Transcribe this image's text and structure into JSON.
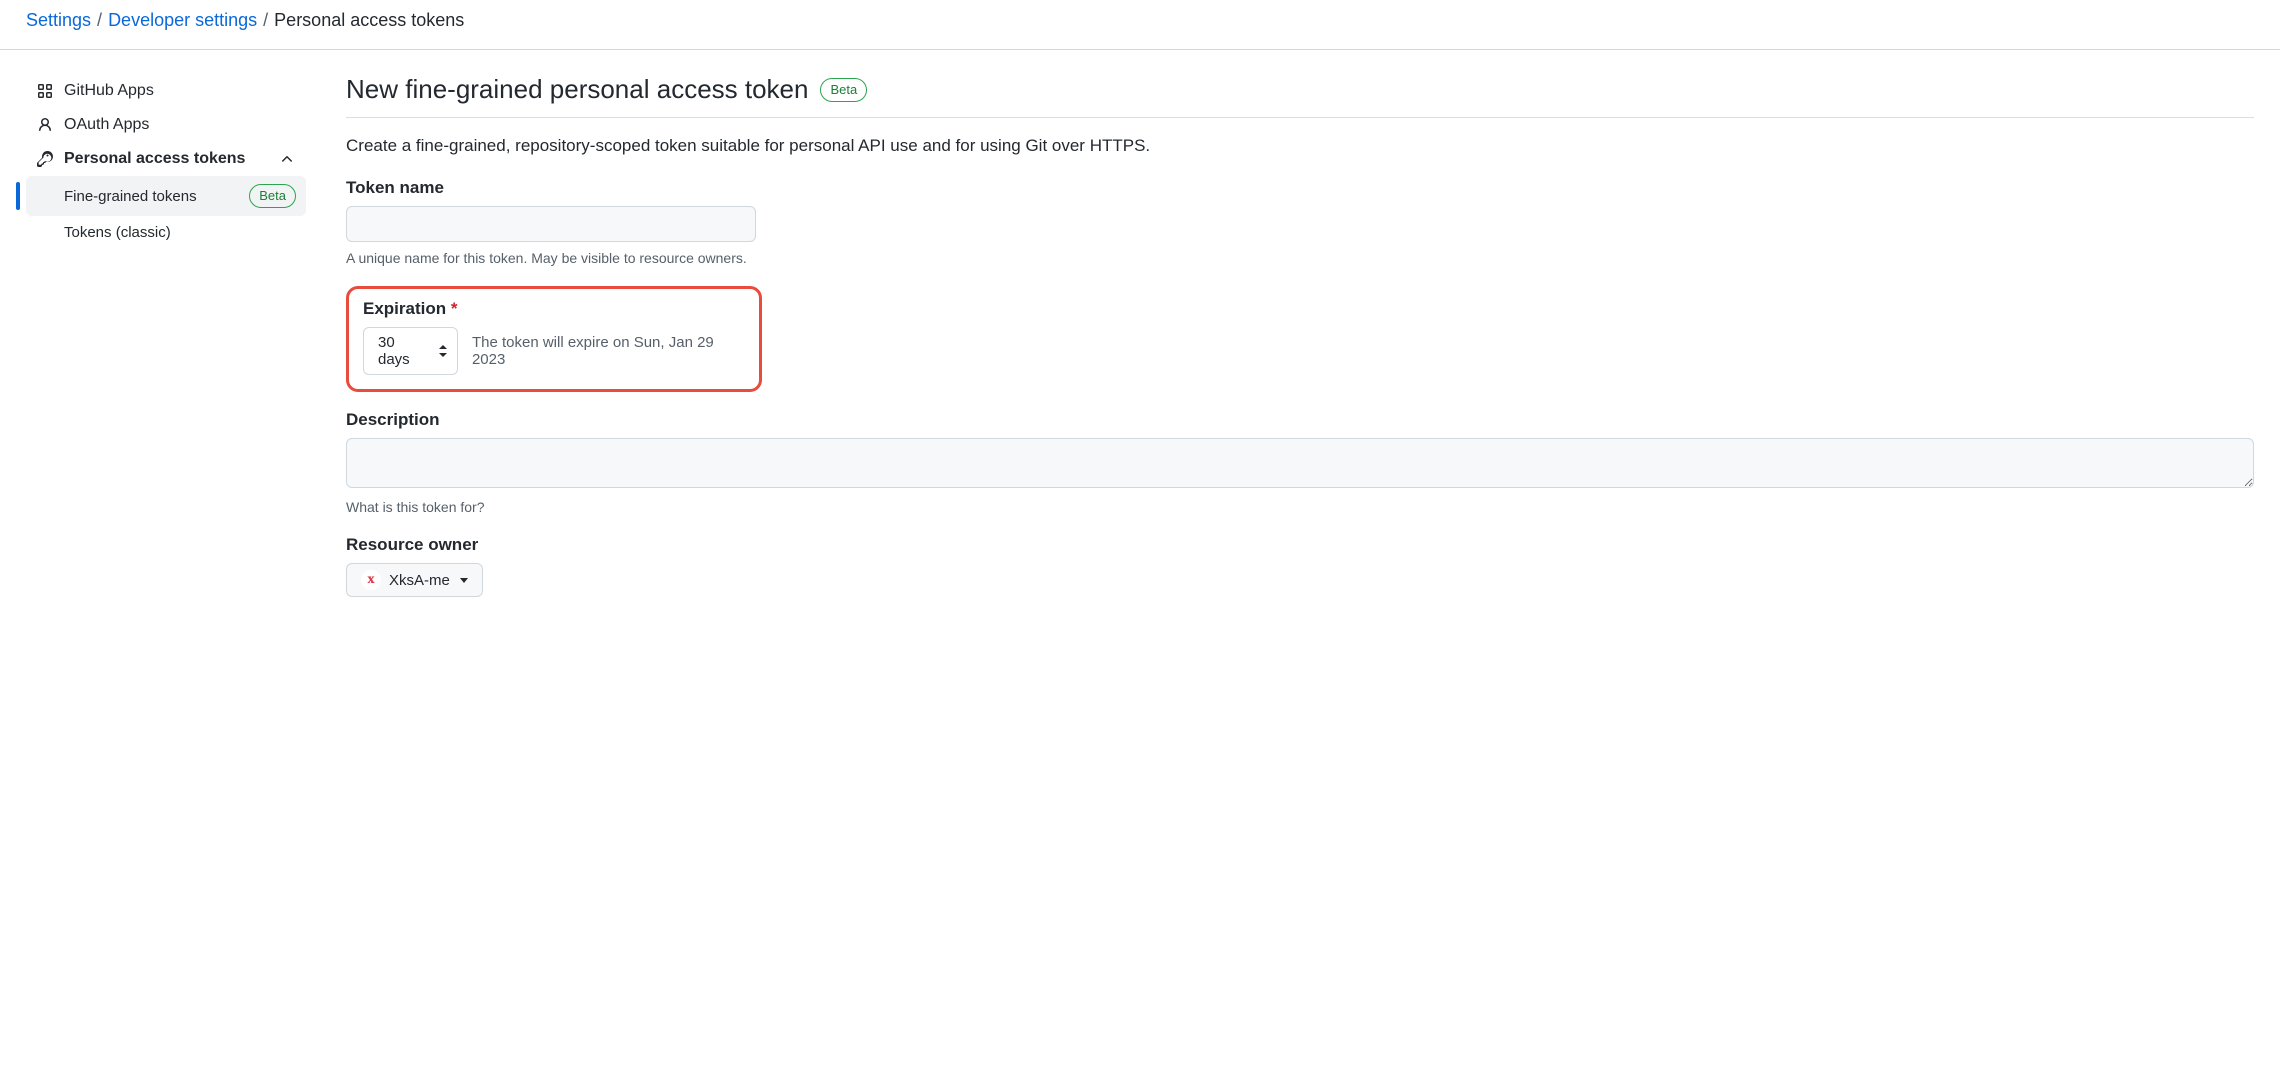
{
  "breadcrumb": {
    "settings": "Settings",
    "developer": "Developer settings",
    "current": "Personal access tokens"
  },
  "sidebar": {
    "github_apps": "GitHub Apps",
    "oauth_apps": "OAuth Apps",
    "pat": "Personal access tokens",
    "fine_grained": "Fine-grained tokens",
    "beta": "Beta",
    "classic": "Tokens (classic)"
  },
  "main": {
    "title": "New fine-grained personal access token",
    "title_badge": "Beta",
    "subtitle": "Create a fine-grained, repository-scoped token suitable for personal API use and for using Git over HTTPS.",
    "token_name_label": "Token name",
    "token_name_help": "A unique name for this token. May be visible to resource owners.",
    "expiration_label": "Expiration",
    "expiration_value": "30 days",
    "expiration_note": "The token will expire on Sun, Jan 29 2023",
    "description_label": "Description",
    "description_help": "What is this token for?",
    "resource_owner_label": "Resource owner",
    "resource_owner_value": "XksA-me"
  }
}
